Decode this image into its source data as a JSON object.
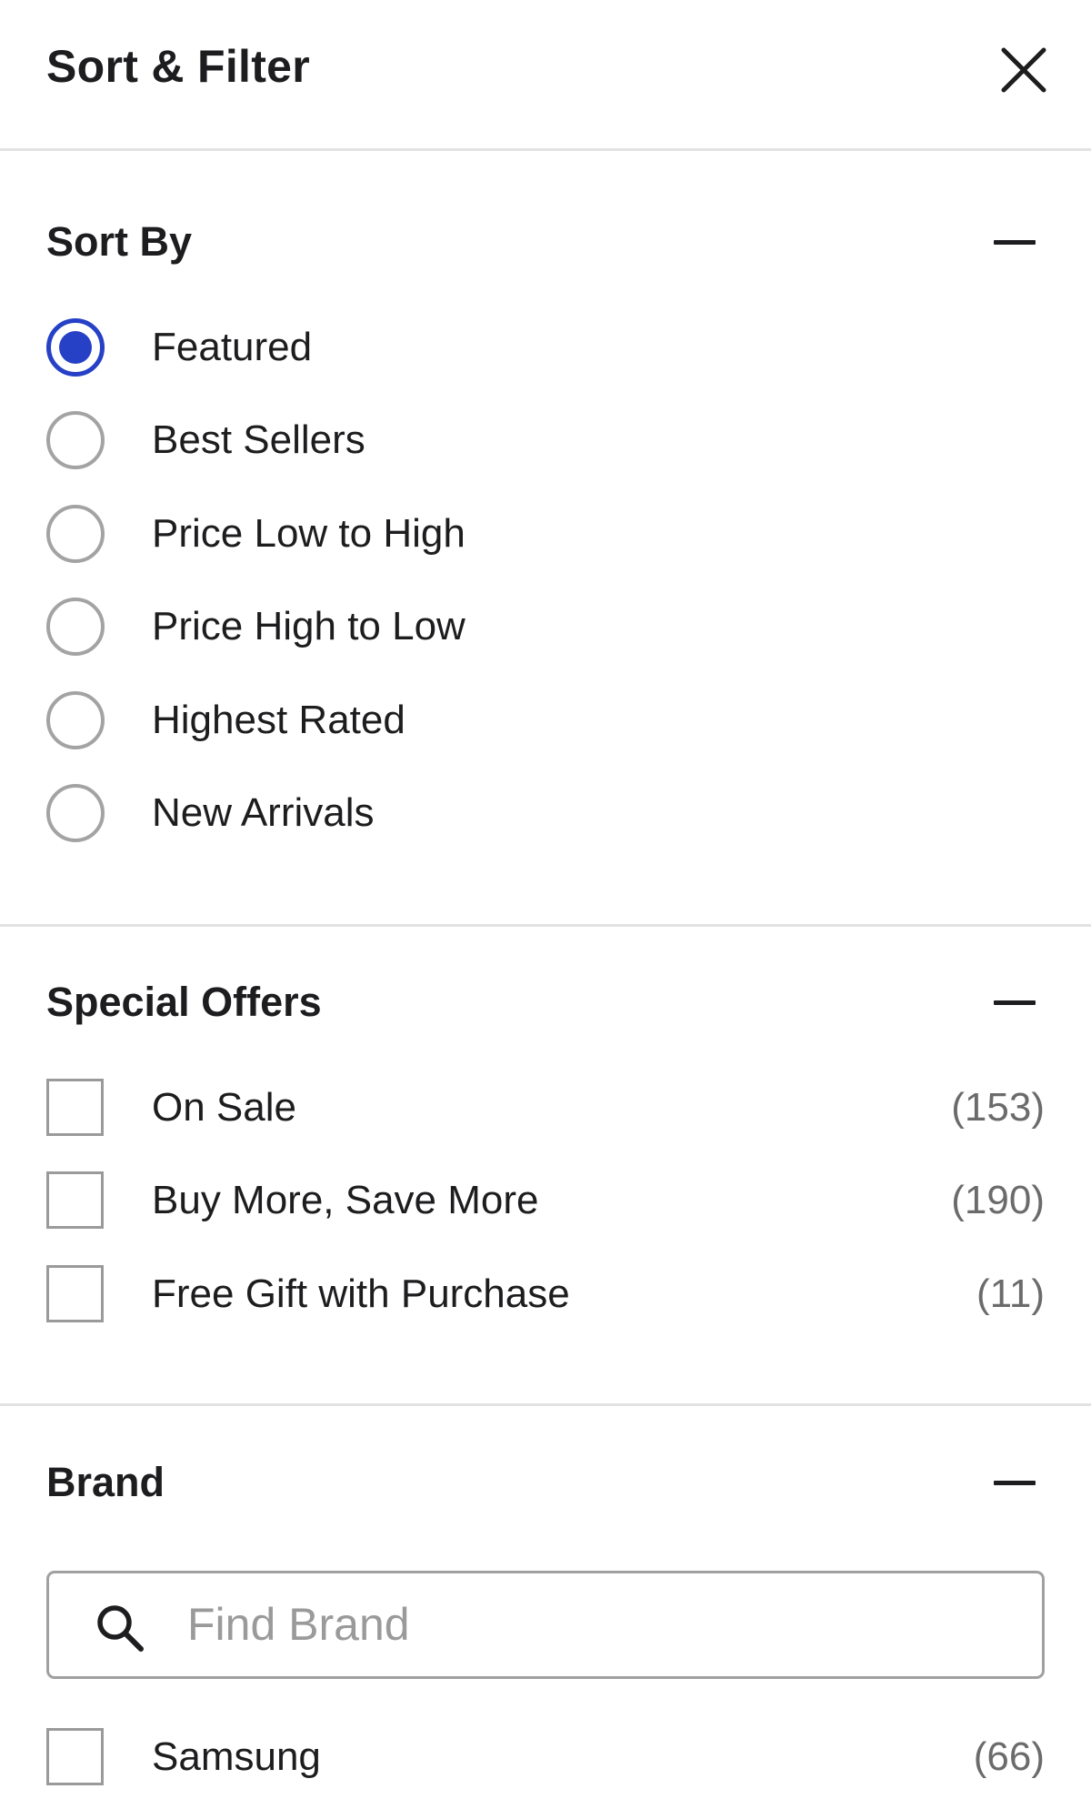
{
  "header": {
    "title": "Sort & Filter",
    "close_icon": "close-icon"
  },
  "sort_by": {
    "title": "Sort By",
    "collapse_icon": "minus-icon",
    "selected": "Featured",
    "options": [
      {
        "label": "Featured",
        "checked": true
      },
      {
        "label": "Best Sellers",
        "checked": false
      },
      {
        "label": "Price Low to High",
        "checked": false
      },
      {
        "label": "Price High to Low",
        "checked": false
      },
      {
        "label": "Highest Rated",
        "checked": false
      },
      {
        "label": "New Arrivals",
        "checked": false
      }
    ]
  },
  "special_offers": {
    "title": "Special Offers",
    "collapse_icon": "minus-icon",
    "options": [
      {
        "label": "On Sale",
        "count": "(153)",
        "checked": false
      },
      {
        "label": "Buy More, Save More",
        "count": "(190)",
        "checked": false
      },
      {
        "label": "Free Gift with Purchase",
        "count": "(11)",
        "checked": false
      }
    ]
  },
  "brand": {
    "title": "Brand",
    "collapse_icon": "minus-icon",
    "search": {
      "placeholder": "Find Brand",
      "value": "",
      "icon": "search-icon"
    },
    "options": [
      {
        "label": "Samsung",
        "count": "(66)",
        "checked": false
      }
    ]
  },
  "colors": {
    "accent": "#2640c6",
    "divider": "#e2e2e2",
    "text": "#1d1d1f",
    "muted": "#6b6b6b"
  }
}
